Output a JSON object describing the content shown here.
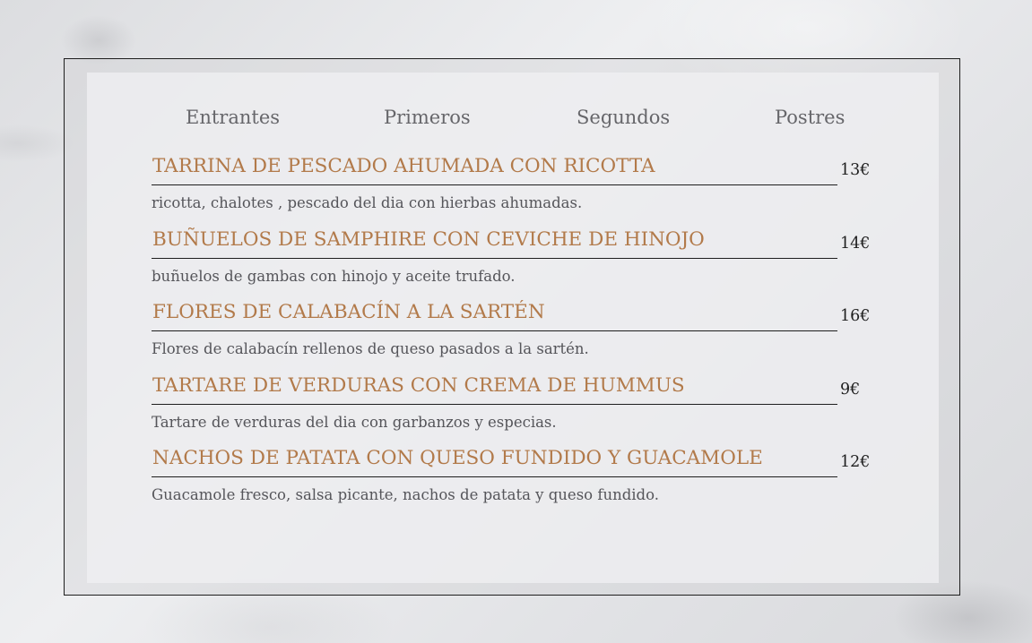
{
  "tabs": [
    "Entrantes",
    "Primeros",
    "Segundos",
    "Postres"
  ],
  "items": [
    {
      "name": "TARRINA DE PESCADO AHUMADA CON RICOTTA",
      "price": "13€",
      "description": "ricotta, chalotes , pescado del dia con hierbas ahumadas."
    },
    {
      "name": "BUÑUELOS DE SAMPHIRE CON CEVICHE DE HINOJO",
      "price": "14€",
      "description": "buñuelos de gambas con hinojo y aceite trufado."
    },
    {
      "name": "FLORES DE CALABACÍN A LA SARTÉN",
      "price": "16€",
      "description": "Flores de calabacín rellenos de queso pasados a la sartén."
    },
    {
      "name": "TARTARE DE VERDURAS CON CREMA DE HUMMUS",
      "price": "9€",
      "description": "Tartare de verduras del dia con garbanzos y especias."
    },
    {
      "name": "NACHOS DE PATATA CON QUESO FUNDIDO Y GUACAMOLE",
      "price": "12€",
      "description": "Guacamole fresco, salsa picante, nachos de patata y queso fundido."
    }
  ],
  "colors": {
    "title": "#b27a4a",
    "description": "#55555a",
    "tab": "#66666a",
    "price": "#1e1e1e",
    "border": "#1e1e1e"
  }
}
